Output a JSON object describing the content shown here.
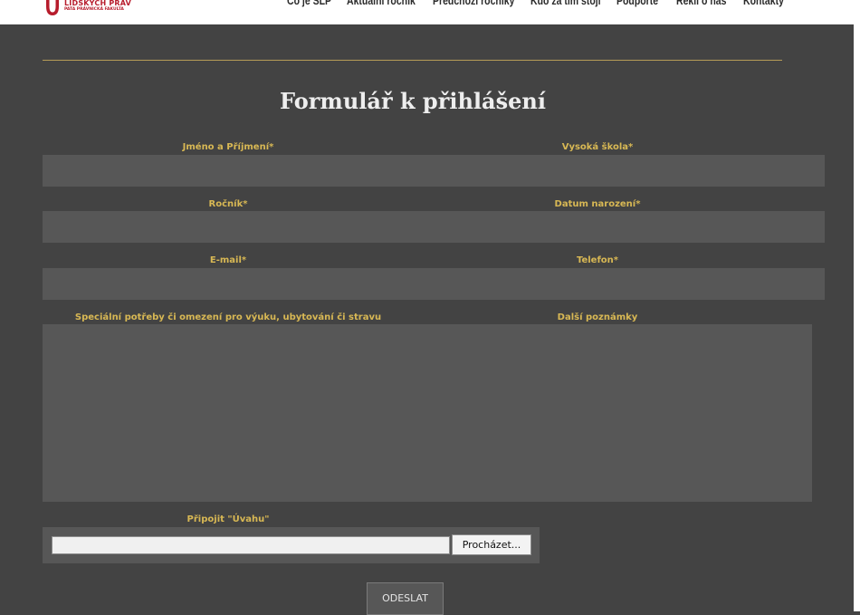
{
  "header": {
    "logo": {
      "title": "LIDSKÝCH PRÁV",
      "subtitle": "PATA PRÁVNICKÁ FAKULTA",
      "brand_color": "#b71c2c"
    },
    "nav": [
      {
        "label": "Co je SLP"
      },
      {
        "label": "Aktuální ročník"
      },
      {
        "label": "Předchozí ročníky"
      },
      {
        "label": "Kdo za tím stojí"
      },
      {
        "label": "Podpořte"
      },
      {
        "label": "Řekli o nás"
      },
      {
        "label": "Kontakty"
      }
    ]
  },
  "form": {
    "title": "Formulář k přihlášení",
    "fields": {
      "name": {
        "label": "Jméno a Příjmení*",
        "value": ""
      },
      "university": {
        "label": "Vysoká škola*",
        "value": ""
      },
      "year": {
        "label": "Ročník*",
        "value": ""
      },
      "birthdate": {
        "label": "Datum narození*",
        "value": ""
      },
      "email": {
        "label": "E-mail*",
        "value": ""
      },
      "phone": {
        "label": "Telefon*",
        "value": ""
      },
      "special_needs": {
        "label": "Speciální potřeby či omezení pro výuku, ubytování či stravu",
        "value": ""
      },
      "notes": {
        "label": "Další poznámky",
        "value": ""
      }
    },
    "attachment": {
      "label": "Připojit \"Úvahu\"",
      "path": "",
      "browse_label": "Procházet..."
    },
    "submit_label": "ODESLAT"
  },
  "colors": {
    "background": "#434343",
    "field": "#575757",
    "label": "#d8b854",
    "divider": "#b69c57"
  }
}
